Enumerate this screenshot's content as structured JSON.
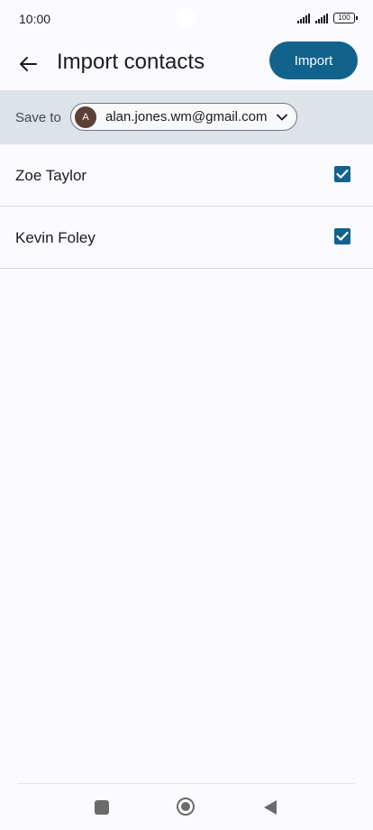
{
  "status_bar": {
    "time": "10:00",
    "battery": "100"
  },
  "app_bar": {
    "back_icon": "arrow-back-icon",
    "title": "Import contacts",
    "import_label": "Import"
  },
  "save_to": {
    "label": "Save to",
    "avatar_initial": "A",
    "account_email": "alan.jones.wm@gmail.com",
    "chevron_icon": "chevron-down-icon"
  },
  "contacts": [
    {
      "name": "Zoe Taylor",
      "checked": true
    },
    {
      "name": "Kevin Foley",
      "checked": true
    }
  ],
  "colors": {
    "accent": "#11638c",
    "save_bar_bg": "#dee3ea",
    "avatar_bg": "#5d4037",
    "page_bg": "#fbfafe"
  },
  "nav_bar": {
    "icons": [
      "recents-square-icon",
      "home-circle-icon",
      "back-triangle-icon"
    ]
  }
}
